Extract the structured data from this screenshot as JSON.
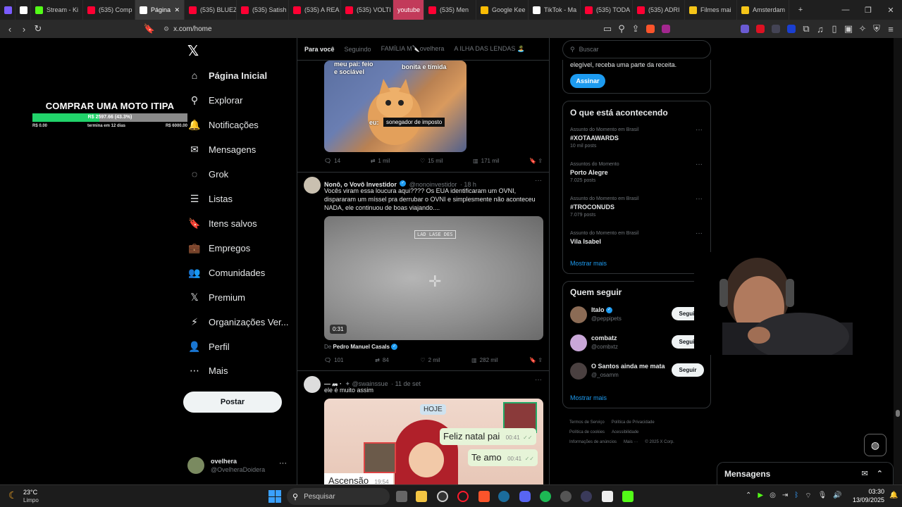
{
  "browser": {
    "tabs": [
      {
        "label": "",
        "color": "#7b5cff"
      },
      {
        "label": "",
        "color": "#ffffff"
      },
      {
        "label": "Stream - Ki",
        "color": "#53fc18"
      },
      {
        "label": "(535) Comp",
        "color": "#ff0033"
      },
      {
        "label": "Página",
        "color": "#ffffff",
        "active": true
      },
      {
        "label": "(535) BLUEZ",
        "color": "#ff0033"
      },
      {
        "label": "(535) Satish",
        "color": "#ff0033"
      },
      {
        "label": "(535) A REA",
        "color": "#ff0033"
      },
      {
        "label": "(535) VOLTI",
        "color": "#ff0033"
      },
      {
        "label": "youtube",
        "color": "#c23a5a",
        "highlight": true
      },
      {
        "label": "(535) Men",
        "color": "#ff0033"
      },
      {
        "label": "Google Kee",
        "color": "#fbbc04"
      },
      {
        "label": "TikTok - Ma",
        "color": "#ffffff"
      },
      {
        "label": "(535) TODA",
        "color": "#ff0033"
      },
      {
        "label": "(535) ADRI",
        "color": "#ff0033"
      },
      {
        "label": "Filmes mai",
        "color": "#f5c518"
      },
      {
        "label": "Amsterdam",
        "color": "#f5c518"
      }
    ],
    "new_tab": "+",
    "url": "x.com/home"
  },
  "overlay": {
    "title": "COMPRAR UMA MOTO ITIPA",
    "bar_text": "R$ 2597.66 (43.3%)",
    "progress": 0.433,
    "min": "R$ 0.00",
    "remaining": "termina em 12 dias",
    "max": "R$ 6000.00"
  },
  "sidebar": {
    "items": [
      {
        "label": "Página Inicial",
        "icon": "home-icon",
        "glyph": "⌂",
        "bold": true
      },
      {
        "label": "Explorar",
        "icon": "search-icon",
        "glyph": "⚲"
      },
      {
        "label": "Notificações",
        "icon": "bell-icon",
        "glyph": "🔔"
      },
      {
        "label": "Mensagens",
        "icon": "mail-icon",
        "glyph": "✉"
      },
      {
        "label": "Grok",
        "icon": "grok-icon",
        "glyph": "◌"
      },
      {
        "label": "Listas",
        "icon": "list-icon",
        "glyph": "☰"
      },
      {
        "label": "Itens salvos",
        "icon": "bookmark-icon",
        "glyph": "🔖"
      },
      {
        "label": "Empregos",
        "icon": "briefcase-icon",
        "glyph": "💼"
      },
      {
        "label": "Comunidades",
        "icon": "people-icon",
        "glyph": "👥"
      },
      {
        "label": "Premium",
        "icon": "x-logo-icon",
        "glyph": "𝕏"
      },
      {
        "label": "Organizações Ver...",
        "icon": "lightning-icon",
        "glyph": "⚡"
      },
      {
        "label": "Perfil",
        "icon": "person-icon",
        "glyph": "👤"
      },
      {
        "label": "Mais",
        "icon": "more-circle-icon",
        "glyph": "⋯"
      }
    ],
    "post_button": "Postar",
    "account": {
      "name": "ovelhera",
      "handle": "@OvelheraDoidera"
    }
  },
  "feed": {
    "tabs": [
      "Para você",
      "Seguindo",
      "FAMÍLIA M🔪ovelhera",
      "A ILHA DAS LENDAS 🏝️"
    ],
    "tweet1": {
      "meme_text_left": "meu pai: feio\ne sociável",
      "meme_text_right": "bonita e tímida",
      "meme_eu": "eu:",
      "meme_label": "sonegador de imposto",
      "replies": "14",
      "retweets": "1 mil",
      "likes": "15 mil",
      "views": "171 mil"
    },
    "tweet2": {
      "name": "Nonô, o Vovô Investidor",
      "handle": "@nonoinvestidor",
      "time": "· 18 h",
      "text": "Vocês viram essa loucura aqui???? Os EUA identificaram um OVNI, dispararam um míssel pra derrubar o OVNI e simplesmente não aconteceu NADA, ele continuou de boas viajando....",
      "video_label": "LAD LASE DES",
      "duration": "0:31",
      "from_prefix": "De",
      "from_name": "Pedro Manuel Casals",
      "replies": "101",
      "retweets": "84",
      "likes": "2 mil",
      "views": "282 mil"
    },
    "tweet3": {
      "name": "— 𝓶 ·",
      "handle": "✦ @swainssue",
      "time": "· 11 de set",
      "text": "ele é muito assim",
      "meme_hoje": "HOJE",
      "bubble1": "Feliz natal pai",
      "bubble1_time": "00:41",
      "bubble2": "Te amo",
      "bubble2_time": "00:41",
      "caption": "Ascensão",
      "caption_time": "19:54"
    }
  },
  "right": {
    "search_placeholder": "Buscar",
    "premium_text": "elegível, receba uma parte da receita.",
    "subscribe": "Assinar",
    "trends_title": "O que está acontecendo",
    "trends": [
      {
        "context": "Assunto do Momento em Brasil",
        "name": "#XOTAAWARDS",
        "posts": "10 mil posts"
      },
      {
        "context": "Assuntos do Momento",
        "name": "Porto Alegre",
        "posts": "7.025 posts"
      },
      {
        "context": "Assunto do Momento em Brasil",
        "name": "#TROCONUDS",
        "posts": "7.079 posts"
      },
      {
        "context": "Assunto do Momento em Brasil",
        "name": "Vila Isabel",
        "posts": ""
      }
    ],
    "show_more": "Mostrar mais",
    "who_title": "Quem seguir",
    "who": [
      {
        "name": "Italo",
        "handle": "@peppipets",
        "verified": true,
        "color": "#8b6b55"
      },
      {
        "name": "combatz",
        "handle": "@combxtz",
        "verified": false,
        "color": "#c9a7d8"
      },
      {
        "name": "O Santos ainda me mata",
        "handle": "@_osamm",
        "verified": false,
        "color": "#4a4040"
      }
    ],
    "follow_label": "Seguir",
    "footer": [
      "Termos de Serviço",
      "Política de Privacidade",
      "Política de cookies",
      "Acessibilidade",
      "Informações de anúncios",
      "Mais ···",
      "© 2025 X Corp."
    ]
  },
  "messages_drawer": {
    "title": "Mensagens"
  },
  "taskbar": {
    "weather_temp": "23°C",
    "weather_desc": "Limpo",
    "search": "Pesquisar",
    "time": "03:30",
    "date": "13/09/2025"
  }
}
